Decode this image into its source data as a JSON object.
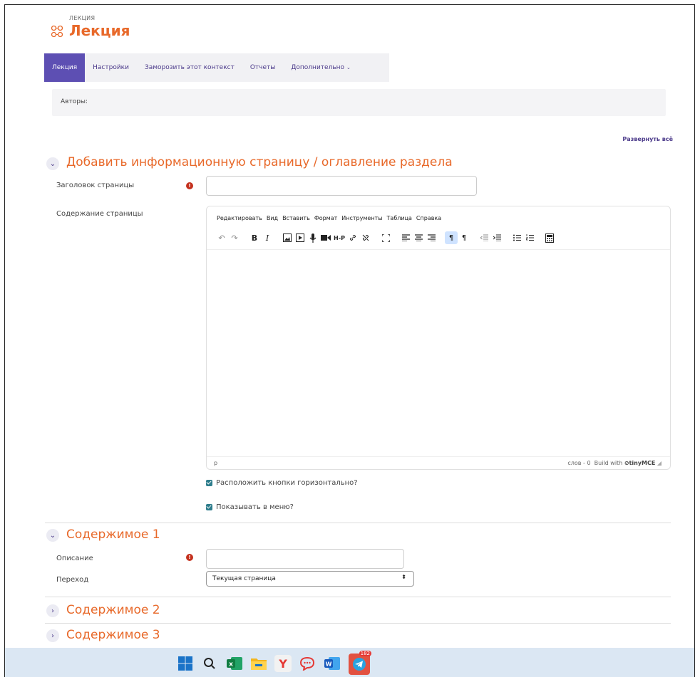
{
  "header": {
    "kicker": "ЛЕКЦИЯ",
    "title": "Лекция",
    "icon": "lesson-icon"
  },
  "tabs": [
    {
      "label": "Лекция",
      "active": true
    },
    {
      "label": "Настройки",
      "active": false
    },
    {
      "label": "Заморозить этот контекст",
      "active": false
    },
    {
      "label": "Отчеты",
      "active": false
    },
    {
      "label": "Дополнительно",
      "active": false,
      "has_caret": true
    }
  ],
  "authors_label": "Авторы:",
  "expand_all": "Развернуть всё",
  "section_main": {
    "title": "Добавить информационную страницу / оглавление раздела",
    "page_title_label": "Заголовок страницы",
    "page_title_value": "",
    "content_label": "Содержание страницы"
  },
  "editor": {
    "menu": [
      "Редактировать",
      "Вид",
      "Вставить",
      "Формат",
      "Инструменты",
      "Таблица",
      "Справка"
    ],
    "status_path": "p",
    "word_count": "слов - 0",
    "build_with": "Build with",
    "brand": "tinyMCE"
  },
  "options": {
    "horizontal_buttons": "Расположить кнопки горизонтально?",
    "show_in_menu": "Показывать в меню?",
    "horizontal_checked": true,
    "menu_checked": true
  },
  "content1": {
    "title": "Содержимое 1",
    "description_label": "Описание",
    "description_value": "",
    "jump_label": "Переход",
    "jump_value": "Текущая страница",
    "jump_arrows": "⬍"
  },
  "content2": {
    "title": "Содержимое 2"
  },
  "content3": {
    "title": "Содержимое 3"
  },
  "glyphs": {
    "chevron_down": "⌄",
    "chevron_right": "›",
    "required": "!"
  },
  "taskbar": {
    "telegram_badge": "182"
  },
  "colors": {
    "accent": "#e8692a",
    "primary": "#5d4fb3",
    "link": "#4b3a8a",
    "required": "#c4311e",
    "checkbox": "#2e7d8c"
  }
}
